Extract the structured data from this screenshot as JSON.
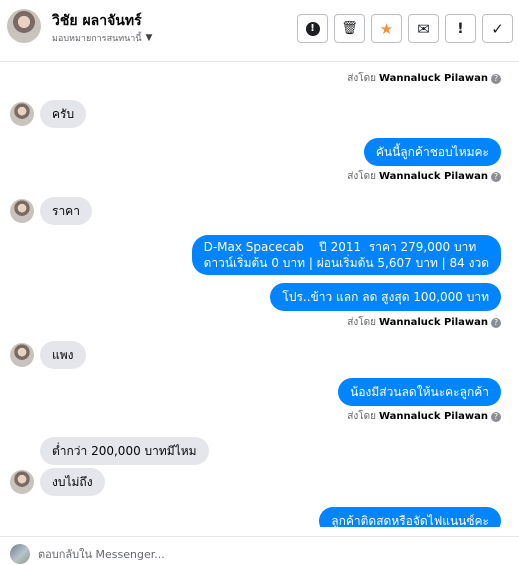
{
  "header": {
    "name": "วิชัย ผลาจันทร์",
    "subtitle": "มอบหมายการสนทนานี้",
    "actions": [
      {
        "name": "report-button",
        "glyph": "!"
      },
      {
        "name": "delete-button",
        "glyph": "🗑"
      },
      {
        "name": "star-button",
        "glyph": "★"
      },
      {
        "name": "mark-unread-button",
        "glyph": "✉"
      },
      {
        "name": "spam-button",
        "glyph": "!"
      },
      {
        "name": "done-button",
        "glyph": "✓"
      }
    ]
  },
  "thread": {
    "sent_prefix": "ส่งโดย",
    "sender": "Wannaluck Pilawan",
    "help_glyph": "?",
    "messages": [
      {
        "dir": "in",
        "text": "ครับ"
      },
      {
        "dir": "out",
        "text": "คันนี้ลูกค้าชอบไหมคะ"
      },
      {
        "dir": "in",
        "text": "ราคา"
      },
      {
        "dir": "out",
        "text": "D-Max Spacecab    ปี 2011  ราคา 279,000 บาท\nดาวน์เริ่มต้น 0 บาท | ผ่อนเริ่มต้น 5,607 บาท | 84 งวด"
      },
      {
        "dir": "out",
        "text": "โปร..ข้าว แลก ลด สูงสุด 100,000 บาท"
      },
      {
        "dir": "in",
        "text": "แพง"
      },
      {
        "dir": "out",
        "text": "น้องมีส่วนลดให้นะคะลูกค้า"
      },
      {
        "dir": "in",
        "text": "ต่ำกว่า 200,000 บาทมีไหม"
      },
      {
        "dir": "in",
        "text": "งบไม่ถึง"
      },
      {
        "dir": "out",
        "text": "ลูกค้าติดสดหรือจัดไฟแนนซ์คะ"
      }
    ]
  },
  "composer": {
    "placeholder": "ตอบกลับใน Messenger..."
  }
}
